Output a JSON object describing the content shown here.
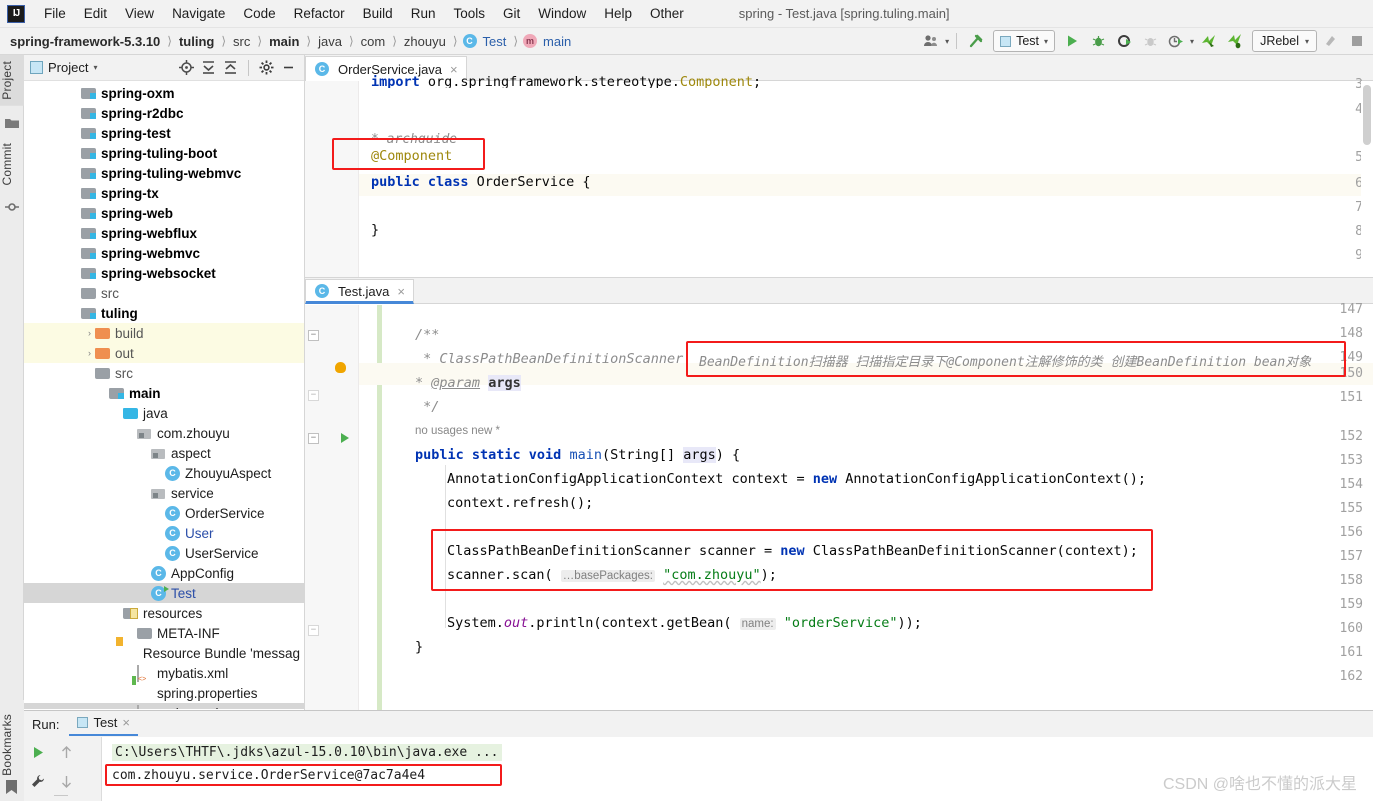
{
  "window": {
    "title": "spring - Test.java [spring.tuling.main]",
    "logo_text": "IJ"
  },
  "menu": {
    "items": [
      "File",
      "Edit",
      "View",
      "Navigate",
      "Code",
      "Refactor",
      "Build",
      "Run",
      "Tools",
      "Git",
      "Window",
      "Help",
      "Other"
    ]
  },
  "breadcrumb": {
    "items": [
      {
        "label": "spring-framework-5.3.10",
        "bold": true,
        "icon": ""
      },
      {
        "label": "tuling",
        "bold": true,
        "icon": ""
      },
      {
        "label": "src",
        "bold": false,
        "icon": ""
      },
      {
        "label": "main",
        "bold": true,
        "icon": ""
      },
      {
        "label": "java",
        "bold": false,
        "icon": ""
      },
      {
        "label": "com",
        "bold": false,
        "icon": ""
      },
      {
        "label": "zhouyu",
        "bold": false,
        "icon": ""
      },
      {
        "label": "Test",
        "bold": false,
        "icon": "class-icon"
      },
      {
        "label": "main",
        "bold": false,
        "icon": "method-icon"
      }
    ],
    "separator": "〉"
  },
  "toolbar": {
    "run_config_label": "Test",
    "jrebel_label": "JRebel",
    "caret": "▾",
    "icons": [
      "user-avatar-icon",
      "hammer-build-icon",
      "run-icon",
      "debug-icon",
      "run-coverage-icon",
      "profiler-icon",
      "attach-icon",
      "jrebel-run-icon",
      "jrebel-debug-icon"
    ]
  },
  "left_stripe": {
    "tabs": [
      "Project",
      "Commit"
    ],
    "bottom_tabs": [
      "Bookmarks"
    ]
  },
  "project_panel": {
    "title": "Project",
    "title_caret": "▾",
    "actions": [
      "locate-icon",
      "expand-all-icon",
      "collapse-all-icon",
      "settings-gear-icon",
      "hide-icon"
    ],
    "tree": [
      {
        "label": "spring-oxm",
        "indent": 3,
        "icon": "module-folder-icon",
        "style": "bold",
        "arrow": "",
        "hl": ""
      },
      {
        "label": "spring-r2dbc",
        "indent": 3,
        "icon": "module-folder-icon",
        "style": "bold",
        "arrow": "",
        "hl": ""
      },
      {
        "label": "spring-test",
        "indent": 3,
        "icon": "module-folder-icon",
        "style": "bold",
        "arrow": "",
        "hl": ""
      },
      {
        "label": "spring-tuling-boot",
        "indent": 3,
        "icon": "module-folder-icon",
        "style": "bold",
        "arrow": "",
        "hl": ""
      },
      {
        "label": "spring-tuling-webmvc",
        "indent": 3,
        "icon": "module-folder-icon",
        "style": "bold",
        "arrow": "",
        "hl": ""
      },
      {
        "label": "spring-tx",
        "indent": 3,
        "icon": "module-folder-icon",
        "style": "bold",
        "arrow": "",
        "hl": ""
      },
      {
        "label": "spring-web",
        "indent": 3,
        "icon": "module-folder-icon",
        "style": "bold",
        "arrow": "",
        "hl": ""
      },
      {
        "label": "spring-webflux",
        "indent": 3,
        "icon": "module-folder-icon",
        "style": "bold",
        "arrow": "",
        "hl": ""
      },
      {
        "label": "spring-webmvc",
        "indent": 3,
        "icon": "module-folder-icon",
        "style": "bold",
        "arrow": "",
        "hl": ""
      },
      {
        "label": "spring-websocket",
        "indent": 3,
        "icon": "module-folder-icon",
        "style": "bold",
        "arrow": "",
        "hl": ""
      },
      {
        "label": "src",
        "indent": 3,
        "icon": "folder-icon",
        "style": "gray",
        "arrow": "",
        "hl": ""
      },
      {
        "label": "tuling",
        "indent": 3,
        "icon": "module-folder-icon",
        "style": "bold",
        "arrow": "",
        "hl": ""
      },
      {
        "label": "build",
        "indent": 4,
        "icon": "orange-folder-icon",
        "style": "gray",
        "arrow": "›",
        "hl": "yellow"
      },
      {
        "label": "out",
        "indent": 4,
        "icon": "orange-folder-icon",
        "style": "gray",
        "arrow": "›",
        "hl": "yellow"
      },
      {
        "label": "src",
        "indent": 4,
        "icon": "folder-icon",
        "style": "gray",
        "arrow": "",
        "hl": ""
      },
      {
        "label": "main",
        "indent": 5,
        "icon": "module-folder-icon",
        "style": "bold",
        "arrow": "",
        "hl": ""
      },
      {
        "label": "java",
        "indent": 6,
        "icon": "source-folder-icon",
        "style": "normal",
        "arrow": "",
        "hl": ""
      },
      {
        "label": "com.zhouyu",
        "indent": 7,
        "icon": "package-icon",
        "style": "normal",
        "arrow": "",
        "hl": ""
      },
      {
        "label": "aspect",
        "indent": 8,
        "icon": "package-icon",
        "style": "normal",
        "arrow": "",
        "hl": ""
      },
      {
        "label": "ZhouyuAspect",
        "indent": 9,
        "icon": "class-icon",
        "style": "normal",
        "arrow": "",
        "hl": ""
      },
      {
        "label": "service",
        "indent": 8,
        "icon": "package-icon",
        "style": "normal",
        "arrow": "",
        "hl": ""
      },
      {
        "label": "OrderService",
        "indent": 9,
        "icon": "class-icon",
        "style": "normal",
        "arrow": "",
        "hl": ""
      },
      {
        "label": "User",
        "indent": 9,
        "icon": "class-icon",
        "style": "blue",
        "arrow": "",
        "hl": ""
      },
      {
        "label": "UserService",
        "indent": 9,
        "icon": "class-icon",
        "style": "normal",
        "arrow": "",
        "hl": ""
      },
      {
        "label": "AppConfig",
        "indent": 8,
        "icon": "class-icon",
        "style": "normal",
        "arrow": "",
        "hl": ""
      },
      {
        "label": "Test",
        "indent": 8,
        "icon": "runnable-class-icon",
        "style": "blue",
        "arrow": "",
        "hl": "selected"
      },
      {
        "label": "resources",
        "indent": 6,
        "icon": "resource-folder-icon",
        "style": "normal",
        "arrow": "",
        "hl": ""
      },
      {
        "label": "META-INF",
        "indent": 7,
        "icon": "folder-icon",
        "style": "normal",
        "arrow": "",
        "hl": ""
      },
      {
        "label": "Resource Bundle 'messag",
        "indent": 7,
        "icon": "resource-bundle-icon",
        "style": "normal",
        "arrow": "",
        "hl": ""
      },
      {
        "label": "mybatis.xml",
        "indent": 7,
        "icon": "xml-file-icon",
        "style": "normal",
        "arrow": "",
        "hl": ""
      },
      {
        "label": "spring.properties",
        "indent": 7,
        "icon": "properties-file-icon",
        "style": "normal",
        "arrow": "",
        "hl": ""
      },
      {
        "label": "spring.xml",
        "indent": 7,
        "icon": "xml-file-icon",
        "style": "normal",
        "arrow": "",
        "hl": "selected"
      }
    ]
  },
  "editor_top": {
    "tab": {
      "label": "OrderService.java",
      "icon": "class-icon",
      "close": "×"
    },
    "lines": [
      {
        "num": "3",
        "clipped": true,
        "segments": [
          {
            "t": "import ",
            "c": "kw"
          },
          {
            "t": "org.springframework.stereotype.",
            "c": "plain"
          },
          {
            "t": "Component",
            "c": "ann"
          },
          {
            "t": ";",
            "c": "plain"
          }
        ]
      },
      {
        "num": "4",
        "segments": []
      },
      {
        "num": "",
        "clipped_comment": "* archguide",
        "segments": []
      },
      {
        "num": "5",
        "segments": [
          {
            "t": "@Component",
            "c": "ann"
          }
        ]
      },
      {
        "num": "6",
        "highlight": true,
        "segments": [
          {
            "t": "public ",
            "c": "kw"
          },
          {
            "t": "class ",
            "c": "kw"
          },
          {
            "t": "OrderService {",
            "c": "plain"
          }
        ]
      },
      {
        "num": "7",
        "segments": []
      },
      {
        "num": "8",
        "segments": [
          {
            "t": "}",
            "c": "plain"
          }
        ]
      },
      {
        "num": "9",
        "segments": []
      }
    ],
    "annotation_box": "red-box-component"
  },
  "editor_bottom": {
    "tab": {
      "label": "Test.java",
      "icon": "runnable-class-icon",
      "close": "×"
    },
    "line_numbers": [
      "147",
      "148",
      "149",
      "150",
      "151",
      "152",
      "153",
      "154",
      "155",
      "156",
      "157",
      "158",
      "159",
      "160",
      "161",
      "162"
    ],
    "usage_hint": "no usages   new *",
    "red_annotation": "BeanDefinition扫描器  扫描指定目录下@Component注解修饰的类  创建BeanDefinition bean对象",
    "code": {
      "l148": "/**",
      "l149": " * ClassPathBeanDefinitionScanner",
      "l150": " * @param args",
      "l151": " */",
      "l152": "public static void main(String[] args) {",
      "l153": "AnnotationConfigApplicationContext context = new AnnotationConfigApplicationContext();",
      "l154": "context.refresh();",
      "l156": "ClassPathBeanDefinitionScanner scanner = new ClassPathBeanDefinitionScanner(context);",
      "l157": "scanner.scan( …basePackages: \"com.zhouyu\");",
      "l159": "System.out.println(context.getBean( name: \"orderService\"));",
      "l160": "}"
    },
    "hints": {
      "base_packages": "…basePackages:",
      "name": "name:"
    }
  },
  "run_panel": {
    "label": "Run:",
    "tab_label": "Test",
    "tab_close": "×",
    "console_lines": [
      "C:\\Users\\THTF\\.jdks\\azul-15.0.10\\bin\\java.exe ...",
      "com.zhouyu.service.OrderService@7ac7a4e4"
    ],
    "gutter_icons": [
      "rerun-icon",
      "scroll-up-icon",
      "settings-wrench-icon",
      "scroll-down-icon"
    ]
  },
  "watermark": "CSDN @啥也不懂的派大星",
  "colors": {
    "accent_blue": "#4688d8",
    "red_box": "#f31b1b",
    "highlight_yellow": "#fcfbe3",
    "string_green": "#067d17",
    "keyword_blue": "#0033b3",
    "annotation_gold": "#9e880d"
  }
}
